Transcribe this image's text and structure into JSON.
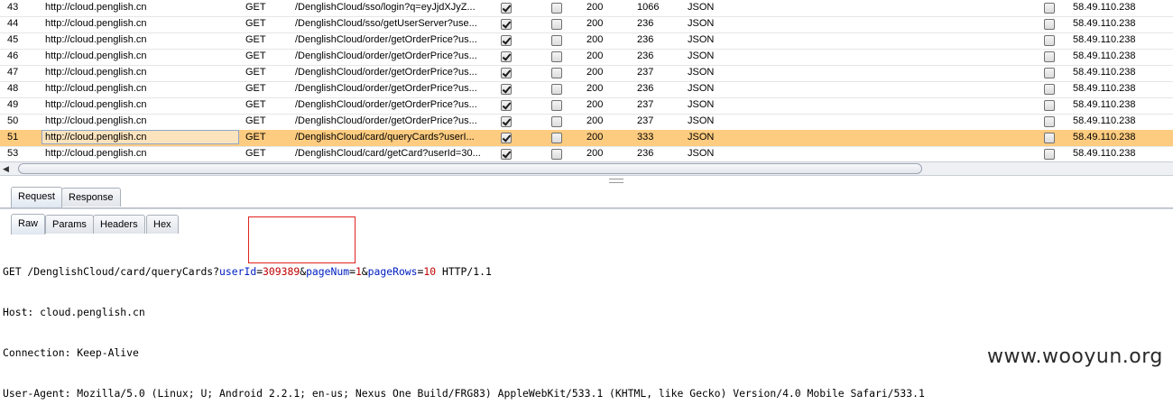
{
  "history": {
    "rows": [
      {
        "num": "43",
        "host": "http://cloud.penglish.cn",
        "method": "GET",
        "url": "/DenglishCloud/sso/login?q=eyJjdXJyZ...",
        "params": true,
        "edited": false,
        "status": "200",
        "length": "1066",
        "mime": "JSON",
        "comment_checked": false,
        "ip": "58.49.110.238",
        "selected": false
      },
      {
        "num": "44",
        "host": "http://cloud.penglish.cn",
        "method": "GET",
        "url": "/DenglishCloud/sso/getUserServer?use...",
        "params": true,
        "edited": false,
        "status": "200",
        "length": "236",
        "mime": "JSON",
        "comment_checked": false,
        "ip": "58.49.110.238",
        "selected": false
      },
      {
        "num": "45",
        "host": "http://cloud.penglish.cn",
        "method": "GET",
        "url": "/DenglishCloud/order/getOrderPrice?us...",
        "params": true,
        "edited": false,
        "status": "200",
        "length": "236",
        "mime": "JSON",
        "comment_checked": false,
        "ip": "58.49.110.238",
        "selected": false
      },
      {
        "num": "46",
        "host": "http://cloud.penglish.cn",
        "method": "GET",
        "url": "/DenglishCloud/order/getOrderPrice?us...",
        "params": true,
        "edited": false,
        "status": "200",
        "length": "236",
        "mime": "JSON",
        "comment_checked": false,
        "ip": "58.49.110.238",
        "selected": false
      },
      {
        "num": "47",
        "host": "http://cloud.penglish.cn",
        "method": "GET",
        "url": "/DenglishCloud/order/getOrderPrice?us...",
        "params": true,
        "edited": false,
        "status": "200",
        "length": "237",
        "mime": "JSON",
        "comment_checked": false,
        "ip": "58.49.110.238",
        "selected": false
      },
      {
        "num": "48",
        "host": "http://cloud.penglish.cn",
        "method": "GET",
        "url": "/DenglishCloud/order/getOrderPrice?us...",
        "params": true,
        "edited": false,
        "status": "200",
        "length": "236",
        "mime": "JSON",
        "comment_checked": false,
        "ip": "58.49.110.238",
        "selected": false
      },
      {
        "num": "49",
        "host": "http://cloud.penglish.cn",
        "method": "GET",
        "url": "/DenglishCloud/order/getOrderPrice?us...",
        "params": true,
        "edited": false,
        "status": "200",
        "length": "237",
        "mime": "JSON",
        "comment_checked": false,
        "ip": "58.49.110.238",
        "selected": false
      },
      {
        "num": "50",
        "host": "http://cloud.penglish.cn",
        "method": "GET",
        "url": "/DenglishCloud/order/getOrderPrice?us...",
        "params": true,
        "edited": false,
        "status": "200",
        "length": "237",
        "mime": "JSON",
        "comment_checked": false,
        "ip": "58.49.110.238",
        "selected": false
      },
      {
        "num": "51",
        "host": "http://cloud.penglish.cn",
        "method": "GET",
        "url": "/DenglishCloud/card/queryCards?userI...",
        "params": true,
        "edited": false,
        "status": "200",
        "length": "333",
        "mime": "JSON",
        "comment_checked": false,
        "ip": "58.49.110.238",
        "selected": true
      },
      {
        "num": "53",
        "host": "http://cloud.penglish.cn",
        "method": "GET",
        "url": "/DenglishCloud/card/getCard?userId=30...",
        "params": true,
        "edited": false,
        "status": "200",
        "length": "236",
        "mime": "JSON",
        "comment_checked": false,
        "ip": "58.49.110.238",
        "selected": false
      }
    ],
    "scroll_left_arrow": "◀"
  },
  "tabs": {
    "top": [
      {
        "label": "Request",
        "active": true
      },
      {
        "label": "Response",
        "active": false
      }
    ],
    "sub": [
      {
        "label": "Raw",
        "active": true
      },
      {
        "label": "Params",
        "active": false
      },
      {
        "label": "Headers",
        "active": false
      },
      {
        "label": "Hex",
        "active": false
      }
    ]
  },
  "raw": {
    "request_line_prefix": "GET /DenglishCloud/card/queryCards",
    "q": "?",
    "p1_name": "userId",
    "p1_eq": "=",
    "p1_val": "309389",
    "amp1": "&",
    "p2_name": "pageNum",
    "p2_eq": "=",
    "p2_val": "1",
    "amp2": "&",
    "p3_name": "pageRows",
    "p3_eq": "=",
    "p3_val": "10",
    "request_line_suffix": " HTTP/1.1",
    "headers": [
      "Host: cloud.penglish.cn",
      "Connection: Keep-Alive",
      "User-Agent: Mozilla/5.0 (Linux; U; Android 2.2.1; en-us; Nexus One Build/FRG83) AppleWebKit/533.1 (KHTML, like Gecko) Version/4.0 Mobile Safari/533.1"
    ]
  },
  "watermark": "www.wooyun.org",
  "colors": {
    "selected_row": "#fecc80",
    "param_name": "#0020c0",
    "param_value": "#c00000",
    "highlight_box": "#e0241e"
  }
}
